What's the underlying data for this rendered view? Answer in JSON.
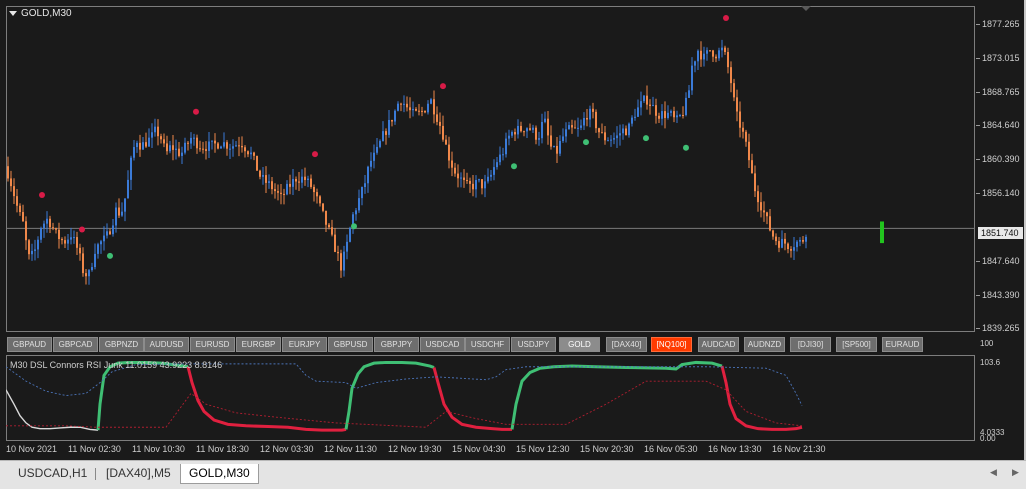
{
  "chart": {
    "symbol_title": "GOLD,M30",
    "current_price": "1851.740",
    "price_ticks": [
      "1877.265",
      "1873.015",
      "1868.765",
      "1864.640",
      "1860.390",
      "1856.140",
      "1847.640",
      "1843.390",
      "1839.265"
    ],
    "price_min": 1838.8,
    "price_max": 1879.5,
    "price_level": 1851.74,
    "colors": {
      "bull": "#3b7bd8",
      "bear": "#f0884a",
      "signal_high": "#d81b47",
      "signal_low": "#3fbf74",
      "marker": "#22c41e"
    }
  },
  "symbols": [
    "GBPAUD",
    "GBPCAD",
    "GBPNZD",
    "AUDUSD",
    "EURUSD",
    "EURGBP",
    "EURJPY",
    "GBPUSD",
    "GBPJPY",
    "USDCAD",
    "USDCHF",
    "USDJPY",
    "GOLD",
    "[DAX40]",
    "[NQ100]",
    "AUDCAD",
    "AUDNZD",
    "[DJI30]",
    "[SP500]",
    "EURAUD"
  ],
  "symbols_active": "GOLD",
  "symbols_hot": "[NQ100]",
  "indicator": {
    "title": "M30 DSL Connors RSI Junk 11.0159 43.9223 8.8146",
    "right_top": "103.6",
    "right_bottom": "4.0333",
    "scale_top": "100",
    "scale_bottom": "0.00",
    "colors": {
      "up": "#3fbf74",
      "down": "#e0203f",
      "neutral": "#d9d9d9",
      "dashed_red": "#b01e30",
      "dashed_blue": "#4b73b8"
    }
  },
  "time_labels": [
    "10 Nov 2021",
    "11 Nov 02:30",
    "11 Nov 10:30",
    "11 Nov 18:30",
    "12 Nov 03:30",
    "12 Nov 11:30",
    "12 Nov 19:30",
    "15 Nov 04:30",
    "15 Nov 12:30",
    "15 Nov 20:30",
    "16 Nov 05:30",
    "16 Nov 13:30",
    "16 Nov 21:30"
  ],
  "tabs": [
    "USDCAD,H1",
    "[DAX40],M5",
    "GOLD,M30"
  ],
  "active_tab": "GOLD,M30"
}
